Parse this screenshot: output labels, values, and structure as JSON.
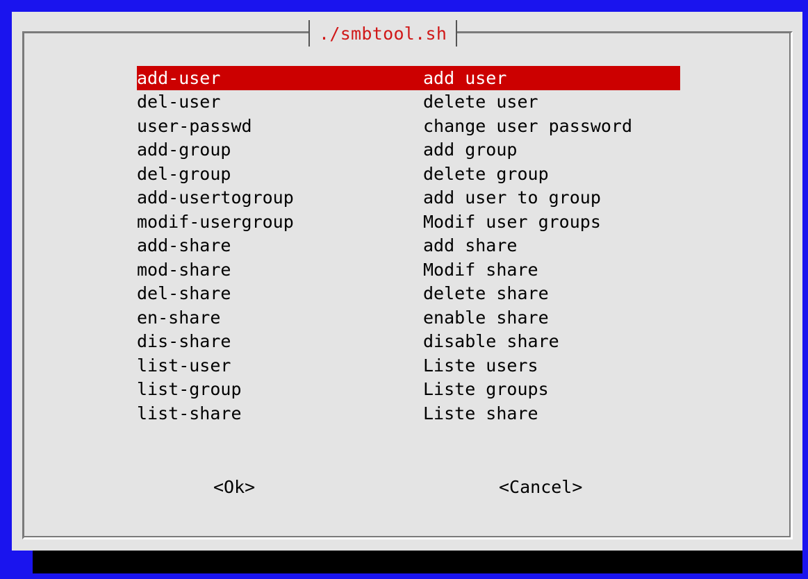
{
  "dialog": {
    "title": "./smbtool.sh"
  },
  "menu": {
    "items": [
      {
        "tag": "add-user",
        "desc": "add user",
        "selected": true
      },
      {
        "tag": "del-user",
        "desc": "delete user"
      },
      {
        "tag": "user-passwd",
        "desc": "change user password"
      },
      {
        "tag": "add-group",
        "desc": "add group"
      },
      {
        "tag": "del-group",
        "desc": "delete group"
      },
      {
        "tag": "add-usertogroup",
        "desc": "add user to group"
      },
      {
        "tag": "modif-usergroup",
        "desc": "Modif user groups"
      },
      {
        "tag": "add-share",
        "desc": "add share"
      },
      {
        "tag": "mod-share",
        "desc": "Modif share"
      },
      {
        "tag": "del-share",
        "desc": "delete share"
      },
      {
        "tag": "en-share",
        "desc": "enable share"
      },
      {
        "tag": "dis-share",
        "desc": "disable share"
      },
      {
        "tag": "list-user",
        "desc": "Liste users"
      },
      {
        "tag": "list-group",
        "desc": "Liste groups"
      },
      {
        "tag": "list-share",
        "desc": "Liste share"
      }
    ]
  },
  "buttons": {
    "ok_label": "<Ok>",
    "cancel_label": "<Cancel>"
  },
  "colors": {
    "background": "#1a14ee",
    "dialog": "#e4e4e4",
    "title": "#d01818",
    "selection": "#cc0000"
  }
}
